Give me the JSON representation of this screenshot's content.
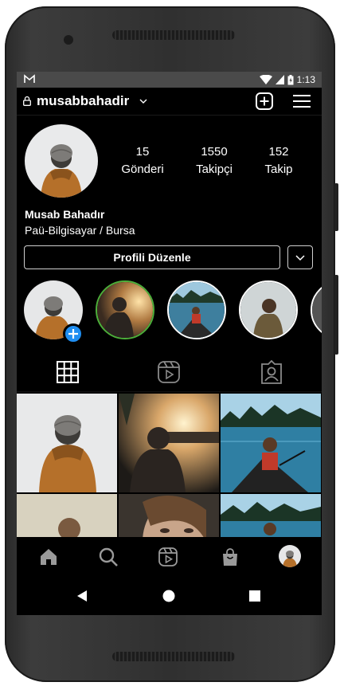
{
  "status": {
    "left_icon": "gmail-icon",
    "time": "1:13",
    "icons": [
      "wifi-icon",
      "signal-icon",
      "battery-icon"
    ]
  },
  "header": {
    "username": "musabbahadir",
    "icons": [
      "lock-icon",
      "chevron-down-icon",
      "new-post-icon",
      "menu-icon"
    ]
  },
  "profile": {
    "stats": [
      {
        "count": "15",
        "label": "Gönderi"
      },
      {
        "count": "1550",
        "label": "Takipçi"
      },
      {
        "count": "152",
        "label": "Takip"
      }
    ],
    "name": "Musab Bahadır",
    "bio": "Paü-Bilgisayar / Bursa",
    "edit_label": "Profili Düzenle"
  },
  "stories": [
    "your-story",
    "story-2",
    "story-3",
    "story-4",
    "story-5"
  ],
  "tabs": [
    "grid-icon",
    "reels-icon",
    "tagged-icon"
  ],
  "bottom_nav": [
    "home-icon",
    "search-icon",
    "reels-icon",
    "shop-icon",
    "profile-avatar"
  ],
  "system_nav": [
    "back-icon",
    "home-circle-icon",
    "recents-icon"
  ],
  "colors": {
    "background": "#000000",
    "text": "#ffffff",
    "accent_blue": "#1f8ef1",
    "story_ring_green": "#4caf3a",
    "status_bar": "#4a4a4a"
  }
}
